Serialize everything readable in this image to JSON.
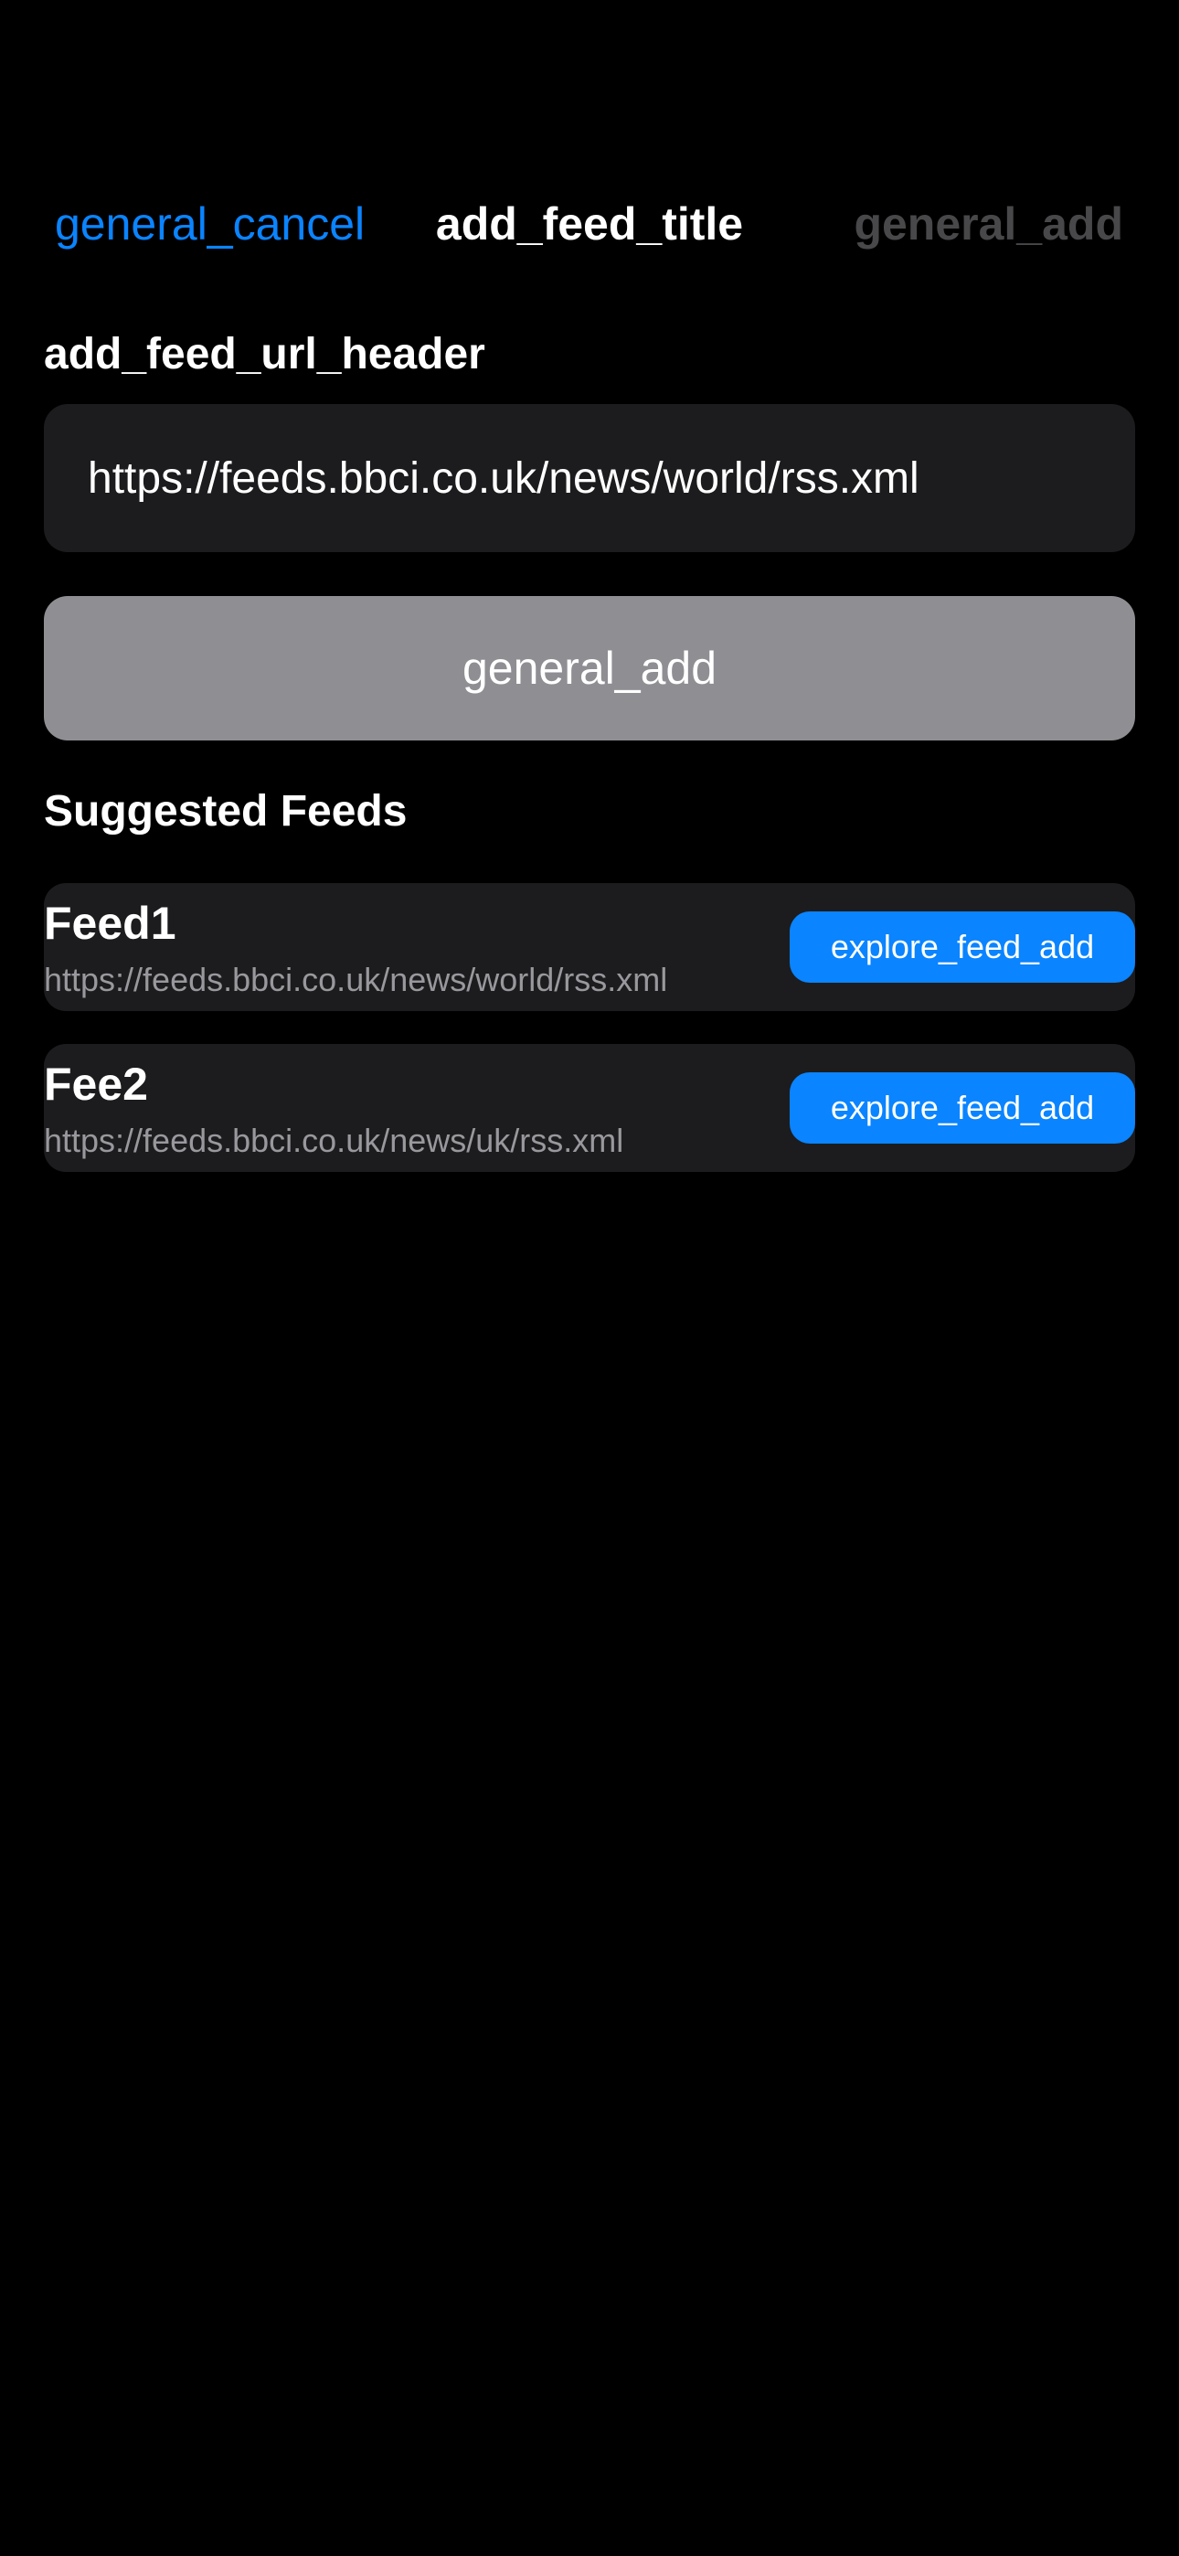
{
  "nav": {
    "cancel_label": "general_cancel",
    "title": "add_feed_title",
    "add_label": "general_add"
  },
  "url_section": {
    "header": "add_feed_url_header",
    "input_value": "https://feeds.bbci.co.uk/news/world/rss.xml"
  },
  "add_button": {
    "label": "general_add"
  },
  "suggested": {
    "header": "Suggested Feeds",
    "feeds": [
      {
        "name": "Feed1",
        "url": "https://feeds.bbci.co.uk/news/world/rss.xml",
        "button_label": "explore_feed_add"
      },
      {
        "name": "Fee2",
        "url": "https://feeds.bbci.co.uk/news/uk/rss.xml",
        "button_label": "explore_feed_add"
      }
    ]
  },
  "colors": {
    "background": "#000000",
    "accent": "#0a84ff",
    "field_background": "#1c1c1e",
    "disabled_button": "#8e8e93",
    "disabled_text": "#48484a",
    "secondary_text": "#98989d"
  }
}
